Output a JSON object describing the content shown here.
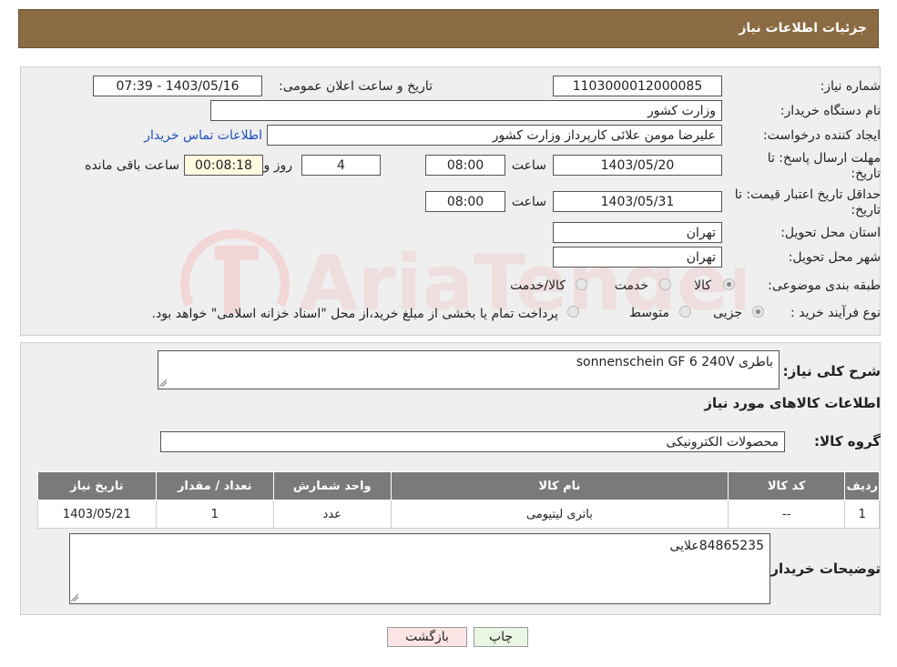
{
  "header": {
    "title": "جزئیات اطلاعات نیاز"
  },
  "info": {
    "need_number_label": "شماره نیاز:",
    "need_number": "1103000012000085",
    "announce_label": "تاریخ و ساعت اعلان عمومی:",
    "announce_value": "1403/05/16 - 07:39",
    "buyer_org_label": "نام دستگاه خریدار:",
    "buyer_org": "وزارت کشور",
    "requester_label": "ایجاد کننده درخواست:",
    "requester": "علیرضا مومن علائی کارپرداز وزارت کشور",
    "contact_link": "اطلاعات تماس خریدار",
    "deadline_label_1": "مهلت ارسال پاسخ: تا",
    "deadline_label_2": "تاریخ:",
    "deadline_date": "1403/05/20",
    "time_label": "ساعت",
    "deadline_time": "08:00",
    "days_value": "4",
    "days_label": "روز و",
    "remaining_value": "00:08:18",
    "remaining_label": "ساعت باقی مانده",
    "validity_label_1": "حداقل تاریخ اعتبار قیمت: تا",
    "validity_label_2": "تاریخ:",
    "validity_date": "1403/05/31",
    "validity_time": "08:00",
    "province_label": "استان محل تحویل:",
    "province": "تهران",
    "city_label": "شهر محل تحویل:",
    "city": "تهران",
    "category_label": "طبقه بندی موضوعی:",
    "category_options": [
      "کالا",
      "خدمت",
      "کالا/خدمت"
    ],
    "process_label": "نوع فرآیند خرید :",
    "process_options": [
      "جزیی",
      "متوسط"
    ],
    "process_note": "پرداخت تمام یا بخشی از مبلغ خرید،از محل \"اسناد خزانه اسلامی\" خواهد بود."
  },
  "detail": {
    "summary_label": "شرح کلی نیاز:",
    "summary": "باطری sonnenschein GF 6 240V",
    "goods_info_title": "اطلاعات کالاهای مورد نیاز",
    "group_label": "گروه کالا:",
    "group_value": "محصولات الکترونیکی",
    "table": {
      "headers": [
        "ردیف",
        "کد کالا",
        "نام کالا",
        "واحد شمارش",
        "تعداد / مقدار",
        "تاریخ نیاز"
      ],
      "rows": [
        [
          "1",
          "--",
          "باتری لیتیومی",
          "عدد",
          "1",
          "1403/05/21"
        ]
      ]
    },
    "buyer_notes_label": "توضیحات خریدار:",
    "buyer_notes": "84865235علایی"
  },
  "buttons": {
    "print": "چاپ",
    "back": "بازگشت"
  },
  "watermark": {
    "text": "AriaTender.neT"
  },
  "colors": {
    "header": "#8b6b43",
    "back_button": "#fbe4e4",
    "print_button": "#e9f6e4",
    "link": "#1a4fc0",
    "table_header": "#7a7a7a"
  }
}
